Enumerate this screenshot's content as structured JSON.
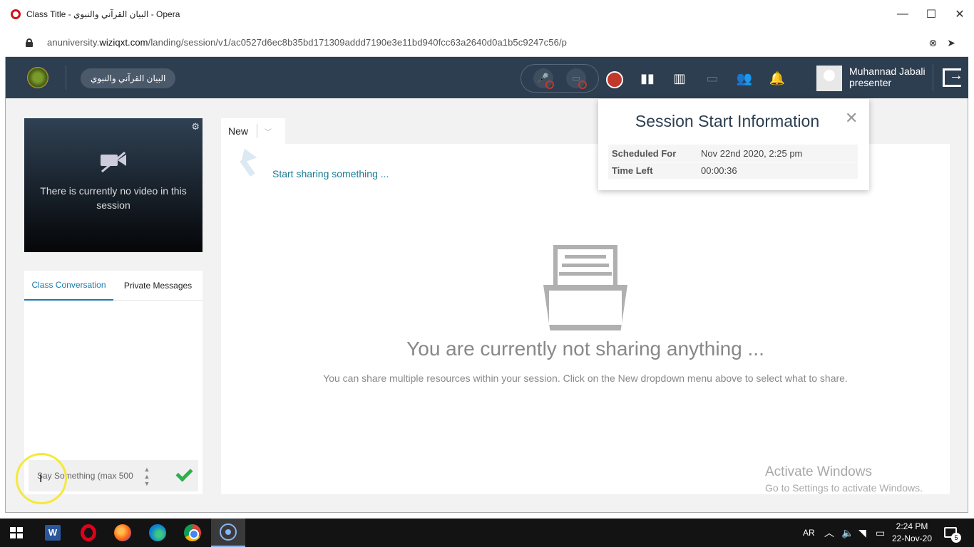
{
  "browser": {
    "window_title": "Class Title - البيان القرآني والنبوي - Opera",
    "url_prefix": "anuniversity.",
    "url_host": "wiziqxt.com",
    "url_path": "/landing/session/v1/ac0527d6ec8b35bd171309addd7190e3e11bd940fcc63a2640d0a1b5c9247c56/p",
    "controls": {
      "minimize": "—",
      "maximize": "☐",
      "close": "✕"
    }
  },
  "header": {
    "class_name": "البيان القرآني والنبوي",
    "user_name": "Muhannad Jabali",
    "user_role": "presenter"
  },
  "video": {
    "message": "There is currently no video in this session"
  },
  "chat": {
    "tabs": [
      "Class Conversation",
      "Private Messages"
    ],
    "input_placeholder": "Say Something (max 500"
  },
  "main": {
    "new_label": "New",
    "start_sharing": "Start sharing something ...",
    "not_sharing": "You are currently not sharing anything ...",
    "share_hint": "You can share multiple resources within your session. Click on the New dropdown menu above to select what to share."
  },
  "popup": {
    "title": "Session Start Information",
    "rows": [
      {
        "key": "Scheduled For",
        "value": "Nov 22nd 2020, 2:25 pm"
      },
      {
        "key": "Time Left",
        "value": "00:00:36"
      }
    ]
  },
  "watermark": {
    "line1": "Activate Windows",
    "line2": "Go to Settings to activate Windows."
  },
  "taskbar": {
    "language": "AR",
    "time": "2:24 PM",
    "date": "22-Nov-20",
    "notification_count": "5"
  },
  "colors": {
    "header_bg": "#2d3e50",
    "accent": "#1a7bb0",
    "send_green": "#2bb24c",
    "record_red": "#c0392b"
  }
}
